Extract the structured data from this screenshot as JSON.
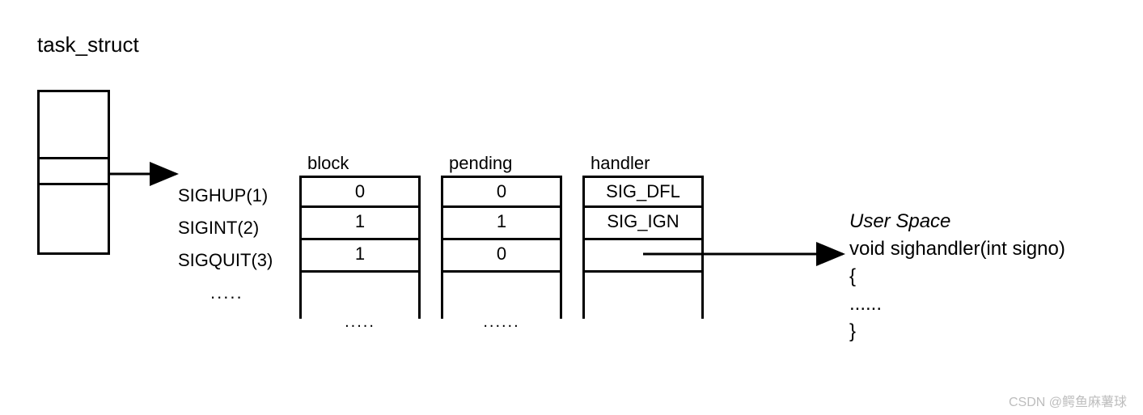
{
  "title": "task_struct",
  "signals": {
    "labels": [
      "SIGHUP(1)",
      "SIGINT(2)",
      "SIGQUIT(3)"
    ],
    "ellipsis": "....."
  },
  "tables": {
    "block": {
      "header": "block",
      "rows": [
        "0",
        "1",
        "1"
      ],
      "ellipsis": "....."
    },
    "pending": {
      "header": "pending",
      "rows": [
        "0",
        "1",
        "0"
      ],
      "ellipsis": "......"
    },
    "handler": {
      "header": "handler",
      "rows": [
        "SIG_DFL",
        "SIG_IGN",
        ""
      ],
      "ellipsis": ""
    }
  },
  "userspace": {
    "title": "User Space",
    "line1": "void sighandler(int signo)",
    "line2": "{",
    "line3": "......",
    "line4": "}"
  },
  "watermark": "CSDN @鳄鱼麻薯球"
}
